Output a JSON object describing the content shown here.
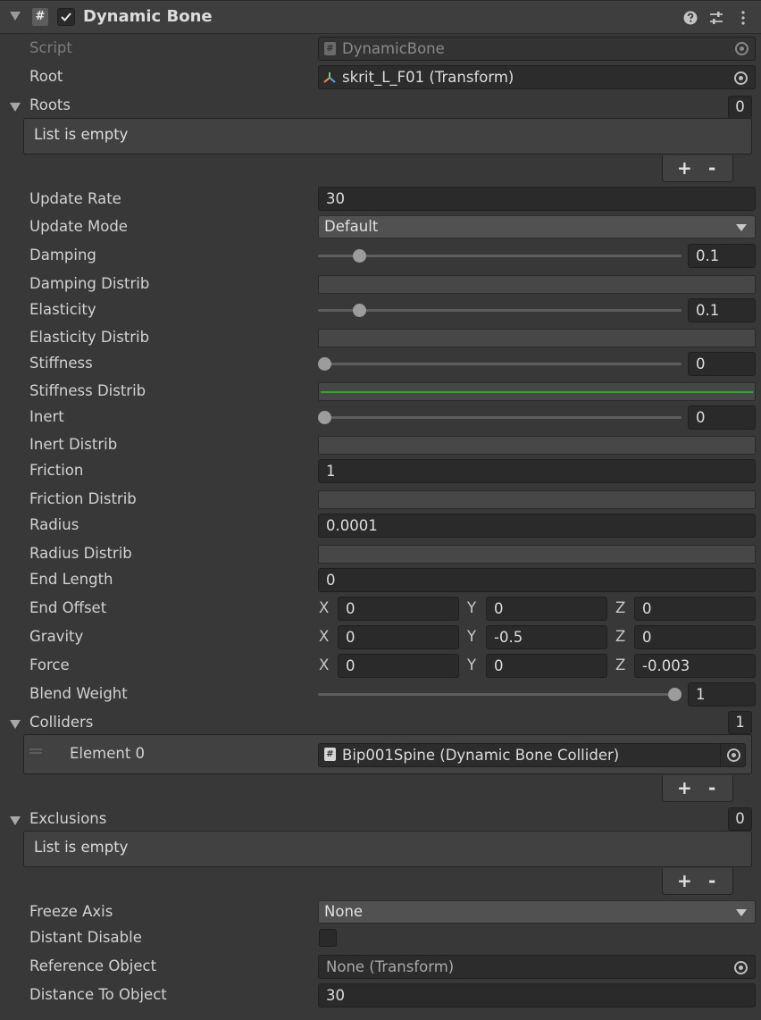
{
  "header": {
    "title": "Dynamic Bone",
    "enabled": true,
    "script_icon_glyph": "#"
  },
  "script": {
    "label": "Script",
    "value": "DynamicBone"
  },
  "root": {
    "label": "Root",
    "value": "skrit_L_F01 (Transform)"
  },
  "roots": {
    "label": "Roots",
    "count": "0",
    "empty_text": "List is empty",
    "plus": "+",
    "minus": "-"
  },
  "update_rate": {
    "label": "Update Rate",
    "value": "30"
  },
  "update_mode": {
    "label": "Update Mode",
    "value": "Default"
  },
  "damping": {
    "label": "Damping",
    "value": "0.1",
    "slider_fraction": 0.1
  },
  "damping_distrib": {
    "label": "Damping Distrib"
  },
  "elasticity": {
    "label": "Elasticity",
    "value": "0.1",
    "slider_fraction": 0.1
  },
  "elasticity_distrib": {
    "label": "Elasticity Distrib"
  },
  "stiffness": {
    "label": "Stiffness",
    "value": "0",
    "slider_fraction": 0
  },
  "stiffness_distrib": {
    "label": "Stiffness Distrib",
    "curve_color": "#1fb31f"
  },
  "inert": {
    "label": "Inert",
    "value": "0",
    "slider_fraction": 0
  },
  "inert_distrib": {
    "label": "Inert Distrib"
  },
  "friction": {
    "label": "Friction",
    "value": "1"
  },
  "friction_distrib": {
    "label": "Friction Distrib"
  },
  "radius": {
    "label": "Radius",
    "value": "0.0001"
  },
  "radius_distrib": {
    "label": "Radius Distrib"
  },
  "end_length": {
    "label": "End Length",
    "value": "0"
  },
  "end_offset": {
    "label": "End Offset",
    "x": "0",
    "y": "0",
    "z": "0"
  },
  "gravity": {
    "label": "Gravity",
    "x": "0",
    "y": "-0.5",
    "z": "0"
  },
  "force": {
    "label": "Force",
    "x": "0",
    "y": "0",
    "z": "-0.003"
  },
  "axis_labels": {
    "x": "X",
    "y": "Y",
    "z": "Z"
  },
  "blend_weight": {
    "label": "Blend Weight",
    "value": "1",
    "slider_fraction": 1
  },
  "colliders": {
    "label": "Colliders",
    "count": "1",
    "plus": "+",
    "minus": "-",
    "elements": [
      {
        "label": "Element 0",
        "value": "Bip001Spine (Dynamic Bone Collider)"
      }
    ]
  },
  "exclusions": {
    "label": "Exclusions",
    "count": "0",
    "empty_text": "List is empty",
    "plus": "+",
    "minus": "-"
  },
  "freeze_axis": {
    "label": "Freeze Axis",
    "value": "None"
  },
  "distant_disable": {
    "label": "Distant Disable",
    "checked": false
  },
  "reference_object": {
    "label": "Reference Object",
    "value": "None (Transform)"
  },
  "distance_to_object": {
    "label": "Distance To Object",
    "value": "30"
  },
  "colors": {
    "background": "#383838",
    "field": "#2a2a2a",
    "curve_green": "#1fb31f"
  }
}
